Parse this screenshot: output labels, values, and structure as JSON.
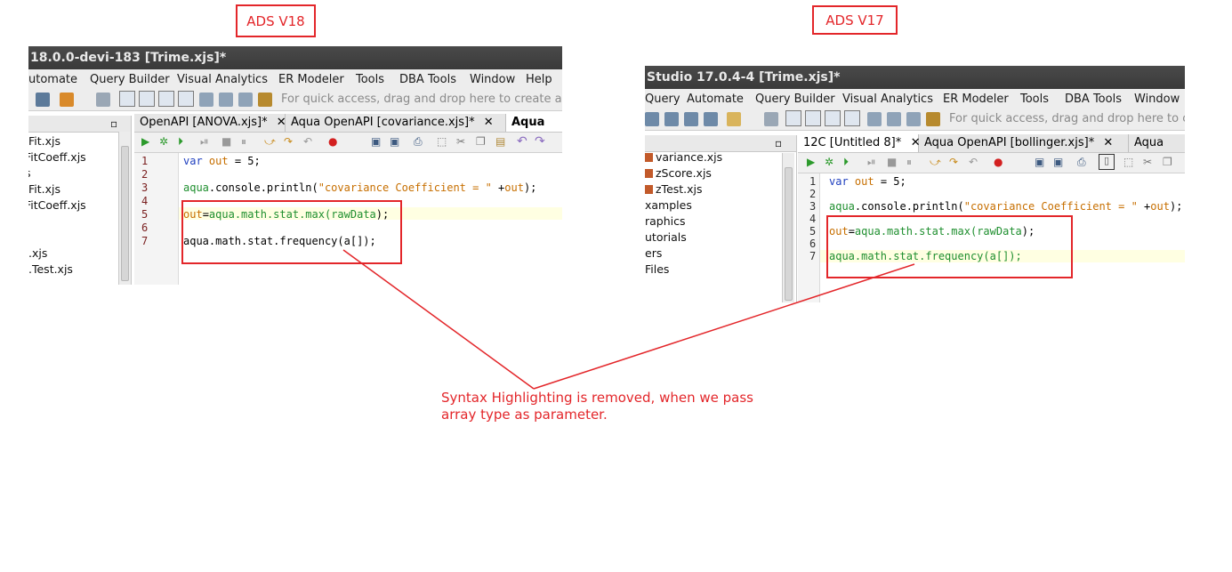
{
  "left": {
    "label": "ADS V18",
    "window_title": "18.0.0-devi-183 [Trime.xjs]*",
    "menu": [
      "utomate",
      "Query Builder",
      "Visual Analytics",
      "ER Modeler",
      "Tools",
      "DBA Tools",
      "Window",
      "Help"
    ],
    "quick_access": "For quick access, drag and drop here to create a s",
    "nav_items": [
      "Fit.xjs",
      "FitCoeff.xjs",
      "s",
      "Fit.xjs",
      "FitCoeff.xjs",
      ".xjs",
      ".Test.xjs"
    ],
    "tabs": [
      "OpenAPI [ANOVA.xjs]*",
      "Aqua OpenAPI [covariance.xjs]*",
      "Aqua"
    ],
    "line_numbers": [
      "1",
      "2",
      "3",
      "4",
      "5",
      "6",
      "7"
    ],
    "code": {
      "l1_kw": "var",
      "l1_var": "out",
      "l1_rest": " = 5;",
      "l3_obj": "aqua",
      "l3_mid": ".console.println(",
      "l3_str": "\"covariance Coefficient = \"",
      "l3_plus": " +",
      "l3_out": "out",
      "l3_end": ");",
      "l5_out": "out",
      "l5_eq": "=",
      "l5_call": "aqua.math.stat.max(",
      "l5_arg": "rawData",
      "l5_end": ");",
      "l7": "aqua.math.stat.frequency(a[]);"
    }
  },
  "right": {
    "label": "ADS V17",
    "window_title": "Studio 17.0.4-4 [Trime.xjs]*",
    "menu": [
      "Query",
      "Automate",
      "Query Builder",
      "Visual Analytics",
      "ER Modeler",
      "Tools",
      "DBA Tools",
      "Window"
    ],
    "quick_access": "For quick access, drag and drop here to c",
    "nav_items": [
      "variance.xjs",
      "zScore.xjs",
      "zTest.xjs",
      "xamples",
      "raphics",
      "utorials",
      "ers",
      "Files"
    ],
    "tabs": [
      "12C [Untitled 8]*",
      "Aqua OpenAPI [bollinger.xjs]*",
      "Aqua"
    ],
    "line_numbers": [
      "1",
      "2",
      "3",
      "4",
      "5",
      "6",
      "7"
    ],
    "code": {
      "l1_kw": "var",
      "l1_var": "out",
      "l1_rest": " = 5;",
      "l3_obj": "aqua",
      "l3_mid": ".console.println(",
      "l3_str": "\"covariance Coefficient = \"",
      "l3_plus": " +",
      "l3_out": "out",
      "l3_end": ");",
      "l5_out": "out",
      "l5_eq": "=",
      "l5_call": "aqua.math.stat.max(",
      "l5_arg": "rawData",
      "l5_end": ");",
      "l7_obj": "aqua",
      "l7_rest": ".math.stat.frequency(a[]);"
    }
  },
  "annotation": {
    "line1": "Syntax Highlighting is removed, when we pass",
    "line2": "array type as parameter."
  },
  "colors": {
    "annotation": "#e3262a",
    "keyword": "#1f3fbf",
    "variable": "#c76f00",
    "string": "#c76f00",
    "green": "#1f8f2f",
    "line_highlight": "#ffffe2"
  }
}
